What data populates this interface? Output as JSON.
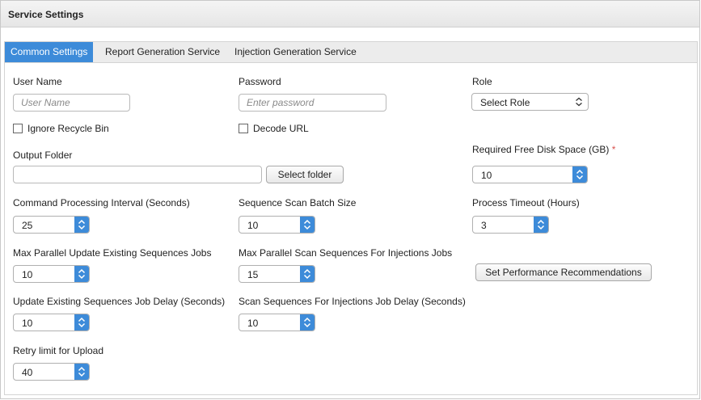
{
  "panel": {
    "title": "Service Settings"
  },
  "tabs": [
    {
      "label": "Common Settings",
      "active": true
    },
    {
      "label": "Report Generation Service",
      "active": false
    },
    {
      "label": "Injection Generation Service",
      "active": false
    }
  ],
  "form": {
    "user_name": {
      "label": "User Name",
      "placeholder": "User Name",
      "value": ""
    },
    "password": {
      "label": "Password",
      "placeholder": "Enter password",
      "value": ""
    },
    "role": {
      "label": "Role",
      "value": "Select Role"
    },
    "ignore_recycle_bin": {
      "label": "Ignore Recycle Bin",
      "checked": false
    },
    "decode_url": {
      "label": "Decode URL",
      "checked": false
    },
    "output_folder": {
      "label": "Output Folder",
      "value": "",
      "button": "Select folder"
    },
    "required_free_disk": {
      "label": "Required Free Disk Space (GB)",
      "required_mark": "*",
      "value": "10"
    },
    "command_interval": {
      "label": "Command Processing Interval (Seconds)",
      "value": "25"
    },
    "sequence_scan_batch": {
      "label": "Sequence Scan Batch Size",
      "value": "10"
    },
    "process_timeout": {
      "label": "Process Timeout (Hours)",
      "value": "3"
    },
    "max_parallel_update": {
      "label": "Max Parallel Update Existing Sequences Jobs",
      "value": "10"
    },
    "max_parallel_scan": {
      "label": "Max Parallel Scan Sequences For Injections Jobs",
      "value": "15"
    },
    "set_perf_button": "Set Performance Recommendations",
    "update_delay": {
      "label": "Update Existing Sequences Job Delay (Seconds)",
      "value": "10"
    },
    "scan_delay": {
      "label": "Scan Sequences For Injections Job Delay (Seconds)",
      "value": "10"
    },
    "retry_limit": {
      "label": "Retry limit for Upload",
      "value": "40"
    }
  },
  "colors": {
    "accent": "#3d8bd9",
    "required": "#d9534f"
  }
}
